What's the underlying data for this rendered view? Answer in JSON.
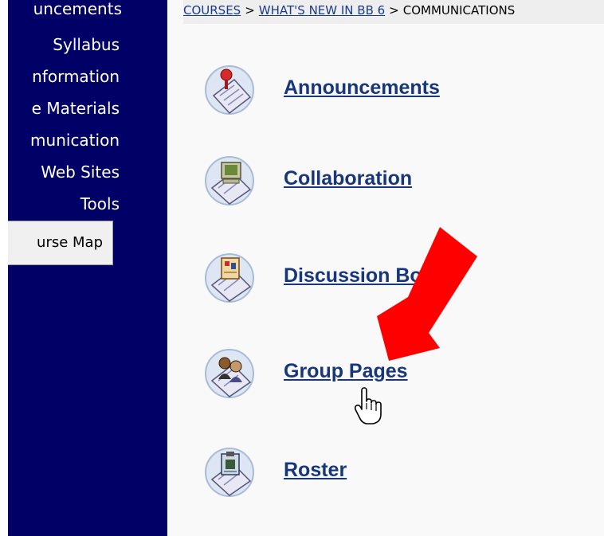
{
  "sidebar": {
    "items": [
      {
        "label": "uncements"
      },
      {
        "label": "Syllabus"
      },
      {
        "label": "nformation"
      },
      {
        "label": "e Materials"
      },
      {
        "label": "munication"
      },
      {
        "label": "Web Sites"
      },
      {
        "label": "Tools"
      }
    ],
    "course_map_label": "urse Map"
  },
  "breadcrumb": {
    "items": [
      "COURSES",
      "WHAT'S NEW IN BB 6",
      "COMMUNICATIONS"
    ],
    "separator": ">"
  },
  "tools": [
    {
      "label": "Announcements",
      "icon": "pushpin-icon"
    },
    {
      "label": "Collaboration",
      "icon": "computer-icon"
    },
    {
      "label": "Discussion Board",
      "icon": "discussion-board-icon"
    },
    {
      "label": "Group Pages",
      "icon": "people-icon"
    },
    {
      "label": "Roster",
      "icon": "clipboard-icon"
    }
  ],
  "colors": {
    "sidebar_bg": "#000066",
    "link": "#17377a",
    "arrow": "#ff0000"
  }
}
